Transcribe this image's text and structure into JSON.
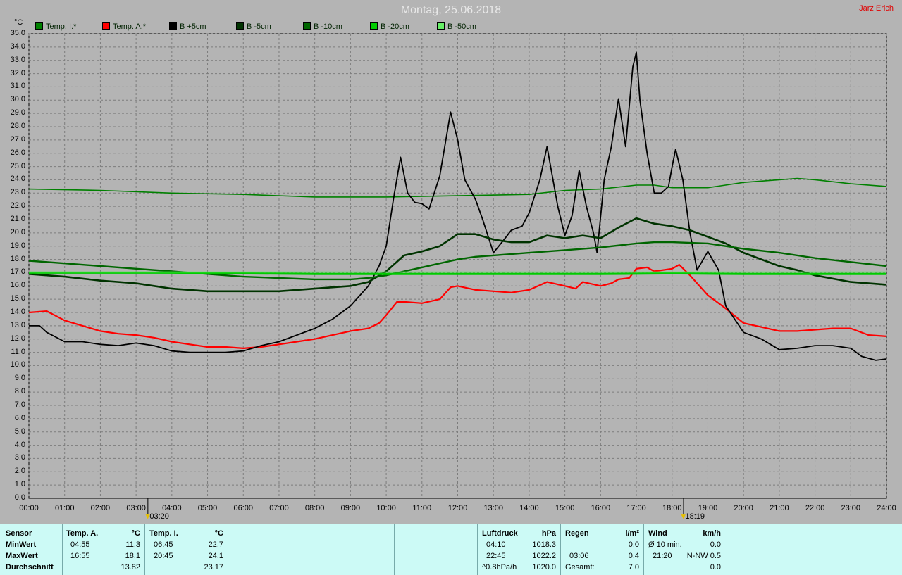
{
  "header": {
    "title": "Montag, 25.06.2018",
    "author": "Jarz Erich",
    "unit_label": "°C"
  },
  "colors": {
    "background": "#b4b4b4",
    "grid": "#7c7c7c",
    "panel": "#ccfaf6"
  },
  "legend": [
    {
      "label": "Temp. I.*",
      "color": "#008000"
    },
    {
      "label": "Temp. A.*",
      "color": "#ff0000"
    },
    {
      "label": "B +5cm",
      "color": "#000000"
    },
    {
      "label": "B -5cm",
      "color": "#003300"
    },
    {
      "label": "B -10cm",
      "color": "#006600"
    },
    {
      "label": "B -20cm",
      "color": "#00cc00"
    },
    {
      "label": "B -50cm",
      "color": "#66ee66"
    }
  ],
  "markers": [
    {
      "label": "03:20",
      "x": 3.33
    },
    {
      "label": "18:19",
      "x": 18.32
    }
  ],
  "chart_data": {
    "type": "line",
    "title": "Montag, 25.06.2018",
    "ylabel": "°C",
    "xlim": [
      0,
      24
    ],
    "ylim": [
      0,
      35
    ],
    "grid": true,
    "legend_position": "top",
    "x_ticks": [
      "00:00",
      "01:00",
      "02:00",
      "03:00",
      "04:00",
      "05:00",
      "06:00",
      "07:00",
      "08:00",
      "09:00",
      "10:00",
      "11:00",
      "12:00",
      "13:00",
      "14:00",
      "15:00",
      "16:00",
      "17:00",
      "18:00",
      "19:00",
      "20:00",
      "21:00",
      "22:00",
      "23:00",
      "24:00"
    ],
    "y_ticks": [
      "0.0",
      "1.0",
      "2.0",
      "3.0",
      "4.0",
      "5.0",
      "6.0",
      "7.0",
      "8.0",
      "9.0",
      "10.0",
      "11.0",
      "12.0",
      "13.0",
      "14.0",
      "15.0",
      "16.0",
      "17.0",
      "18.0",
      "19.0",
      "20.0",
      "21.0",
      "22.0",
      "23.0",
      "24.0",
      "25.0",
      "26.0",
      "27.0",
      "28.0",
      "29.0",
      "30.0",
      "31.0",
      "32.0",
      "33.0",
      "34.0",
      "35.0"
    ],
    "series": [
      {
        "name": "Temp. I.*",
        "color": "#008000",
        "width": 1.6,
        "x": [
          0,
          2,
          4,
          6,
          8,
          10,
          12,
          14,
          15,
          16,
          17,
          17.5,
          18,
          19,
          20,
          21,
          21.5,
          22,
          23,
          24
        ],
        "y": [
          23.3,
          23.2,
          23.0,
          22.9,
          22.7,
          22.7,
          22.8,
          22.9,
          23.2,
          23.3,
          23.6,
          23.6,
          23.4,
          23.4,
          23.8,
          24.0,
          24.1,
          24.0,
          23.7,
          23.5
        ]
      },
      {
        "name": "Temp. A.*",
        "color": "#ff0000",
        "width": 2.2,
        "x": [
          0,
          0.5,
          1,
          1.5,
          2,
          2.5,
          3,
          3.5,
          4,
          4.5,
          5,
          5.5,
          6,
          6.5,
          7,
          7.5,
          8,
          8.5,
          9,
          9.5,
          9.8,
          10,
          10.3,
          10.5,
          11,
          11.5,
          11.8,
          12,
          12.5,
          13,
          13.5,
          14,
          14.5,
          15,
          15.3,
          15.5,
          16,
          16.3,
          16.5,
          16.8,
          17,
          17.3,
          17.5,
          18,
          18.2,
          18.5,
          19,
          19.5,
          20,
          20.5,
          21,
          21.5,
          22,
          22.5,
          23,
          23.5,
          24
        ],
        "y": [
          14.0,
          14.1,
          13.4,
          13.0,
          12.6,
          12.4,
          12.3,
          12.1,
          11.8,
          11.6,
          11.4,
          11.4,
          11.3,
          11.4,
          11.6,
          11.8,
          12.0,
          12.3,
          12.6,
          12.8,
          13.2,
          13.8,
          14.8,
          14.8,
          14.7,
          15.0,
          15.9,
          16.0,
          15.7,
          15.6,
          15.5,
          15.7,
          16.3,
          16.0,
          15.8,
          16.3,
          16.0,
          16.2,
          16.5,
          16.6,
          17.3,
          17.4,
          17.1,
          17.3,
          17.6,
          16.8,
          15.3,
          14.3,
          13.2,
          12.9,
          12.6,
          12.6,
          12.7,
          12.8,
          12.8,
          12.3,
          12.2
        ]
      },
      {
        "name": "B +5cm",
        "color": "#000000",
        "width": 1.8,
        "x": [
          0,
          0.3,
          0.5,
          1,
          1.5,
          2,
          2.5,
          3,
          3.5,
          4,
          4.5,
          5,
          5.5,
          6,
          6.5,
          7,
          7.5,
          8,
          8.5,
          9,
          9.5,
          9.8,
          10,
          10.2,
          10.4,
          10.6,
          10.8,
          11,
          11.2,
          11.5,
          11.8,
          12,
          12.2,
          12.5,
          12.7,
          13,
          13.3,
          13.5,
          13.8,
          14,
          14.3,
          14.5,
          14.8,
          15,
          15.2,
          15.4,
          15.6,
          15.8,
          15.9,
          16.1,
          16.3,
          16.5,
          16.7,
          16.9,
          17,
          17.1,
          17.3,
          17.5,
          17.7,
          17.9,
          18,
          18.1,
          18.3,
          18.5,
          18.7,
          19,
          19.3,
          19.5,
          20,
          20.5,
          21,
          21.5,
          22,
          22.5,
          23,
          23.3,
          23.7,
          24
        ],
        "y": [
          13.0,
          13.0,
          12.5,
          11.8,
          11.8,
          11.6,
          11.5,
          11.7,
          11.5,
          11.1,
          11.0,
          11.0,
          11.0,
          11.1,
          11.5,
          11.8,
          12.3,
          12.8,
          13.5,
          14.5,
          16.0,
          17.5,
          19.0,
          22.5,
          25.7,
          23.0,
          22.3,
          22.2,
          21.8,
          24.3,
          29.1,
          27.0,
          24.0,
          22.5,
          21.0,
          18.5,
          19.5,
          20.2,
          20.5,
          21.5,
          24.0,
          26.5,
          22.0,
          19.8,
          21.3,
          24.7,
          22.0,
          20.0,
          18.5,
          24.0,
          26.5,
          30.1,
          26.5,
          32.5,
          33.6,
          30.0,
          26.0,
          23.0,
          23.0,
          23.5,
          25.0,
          26.3,
          24.0,
          20.0,
          17.2,
          18.6,
          17.2,
          14.5,
          12.5,
          12.0,
          11.2,
          11.3,
          11.5,
          11.5,
          11.3,
          10.7,
          10.4,
          10.5
        ]
      },
      {
        "name": "B -5cm",
        "color": "#003300",
        "width": 2.6,
        "x": [
          0,
          1,
          2,
          3,
          3.5,
          4,
          4.5,
          5,
          6,
          7,
          8,
          9,
          9.5,
          10,
          10.5,
          11,
          11.5,
          12,
          12.5,
          13,
          13.5,
          14,
          14.5,
          15,
          15.5,
          16,
          16.5,
          17,
          17.5,
          18,
          18.5,
          19,
          19.5,
          20,
          20.5,
          21,
          21.5,
          22,
          23,
          24
        ],
        "y": [
          16.9,
          16.7,
          16.4,
          16.2,
          16.0,
          15.8,
          15.7,
          15.6,
          15.6,
          15.6,
          15.8,
          16.0,
          16.3,
          17.1,
          18.3,
          18.6,
          19.0,
          19.9,
          19.9,
          19.5,
          19.3,
          19.3,
          19.8,
          19.6,
          19.8,
          19.6,
          20.4,
          21.1,
          20.7,
          20.5,
          20.2,
          19.7,
          19.2,
          18.5,
          18.0,
          17.5,
          17.2,
          16.8,
          16.3,
          16.1
        ]
      },
      {
        "name": "B -10cm",
        "color": "#006600",
        "width": 2.4,
        "x": [
          0,
          1,
          2,
          3,
          4,
          5,
          6,
          7,
          8,
          9,
          9.5,
          10,
          10.5,
          11,
          11.5,
          12,
          12.5,
          13,
          14,
          15,
          16,
          17,
          17.5,
          18,
          19,
          19.5,
          20,
          21,
          22,
          23,
          24
        ],
        "y": [
          17.9,
          17.7,
          17.5,
          17.3,
          17.1,
          16.9,
          16.7,
          16.6,
          16.5,
          16.5,
          16.6,
          16.8,
          17.1,
          17.4,
          17.7,
          18.0,
          18.2,
          18.3,
          18.5,
          18.7,
          18.9,
          19.2,
          19.3,
          19.3,
          19.2,
          19.0,
          18.8,
          18.5,
          18.1,
          17.8,
          17.5
        ]
      },
      {
        "name": "B -20cm",
        "color": "#00cc00",
        "width": 3,
        "x": [
          0,
          4,
          8,
          10,
          12,
          16,
          18,
          20,
          24
        ],
        "y": [
          17.0,
          17.0,
          16.9,
          16.9,
          16.9,
          16.9,
          16.95,
          16.9,
          16.9
        ]
      },
      {
        "name": "B -50cm",
        "color": "#66ee66",
        "width": 1.5,
        "x": [
          0,
          24
        ],
        "y": [
          17.05,
          17.05
        ]
      }
    ]
  },
  "stats": {
    "sensor": {
      "title": "Sensor",
      "rows": [
        "MinWert",
        "MaxWert",
        "Durchschnitt"
      ]
    },
    "temp_a": {
      "title": "Temp. A.",
      "unit": "°C",
      "min_time": "04:55",
      "min_val": "11.3",
      "max_time": "16:55",
      "max_val": "18.1",
      "avg": "13.82"
    },
    "temp_i": {
      "title": "Temp. I.",
      "unit": "°C",
      "min_time": "06:45",
      "min_val": "22.7",
      "max_time": "20:45",
      "max_val": "24.1",
      "avg": "23.17"
    },
    "pressure": {
      "title": "Luftdruck",
      "unit": "hPa",
      "min_time": "04:10",
      "min_val": "1018.3",
      "max_time": "22:45",
      "max_val": "1022.2",
      "trend": "^0.8hPa/h",
      "avg": "1020.0"
    },
    "rain": {
      "title": "Regen",
      "unit": "l/m²",
      "min_val": "0.0",
      "max_time": "03:06",
      "max_val": "0.4",
      "total_label": "Gesamt:",
      "total": "7.0"
    },
    "wind": {
      "title": "Wind",
      "unit": "km/h",
      "avg_label": "Ø 10 min.",
      "avg_val": "0.0",
      "max_time": "21:20",
      "max_val": "N-NW 0.5",
      "third_val": "0.0"
    }
  }
}
